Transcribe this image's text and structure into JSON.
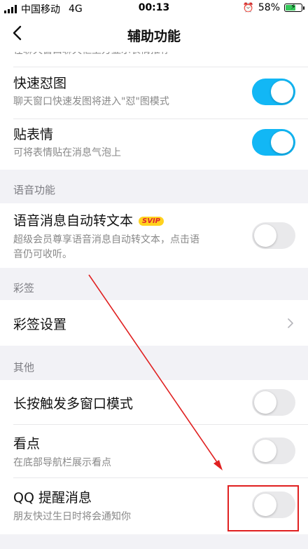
{
  "status_bar": {
    "carrier": "中国移动",
    "network": "4G",
    "time": "00:13",
    "battery": "58%"
  },
  "nav": {
    "title": "辅助功能",
    "back_icon": "chevron-left-icon"
  },
  "top_cut_text": "在聊天窗口聊天框上方显示表情推荐",
  "rows": {
    "quick_meme": {
      "title": "快速怼图",
      "subtitle": "聊天窗口快速发图将进入\"怼\"图模式",
      "on": true
    },
    "sticker": {
      "title": "贴表情",
      "subtitle": "可将表情贴在消息气泡上",
      "on": true
    }
  },
  "sections": {
    "voice": "语音功能",
    "caiqian": "彩签",
    "other": "其他"
  },
  "voice_row": {
    "title": "语音消息自动转文本",
    "badge": "SVIP",
    "subtitle_line1": "超级会员尊享语音消息自动转文本，点击语",
    "subtitle_line2": "音仍可收听。",
    "on": false
  },
  "caiqian_row": {
    "title": "彩签设置"
  },
  "other_rows": {
    "multiwindow": {
      "title": "长按触发多窗口模式",
      "on": false
    },
    "kandian": {
      "title": "看点",
      "subtitle": "在底部导航栏展示看点",
      "on": false
    },
    "qq_reminder": {
      "title": "QQ 提醒消息",
      "subtitle": "朋友快过生日时将会通知你",
      "on": false
    }
  },
  "colors": {
    "toggle_on": "#12b7f5",
    "annotation": "#e02020"
  }
}
